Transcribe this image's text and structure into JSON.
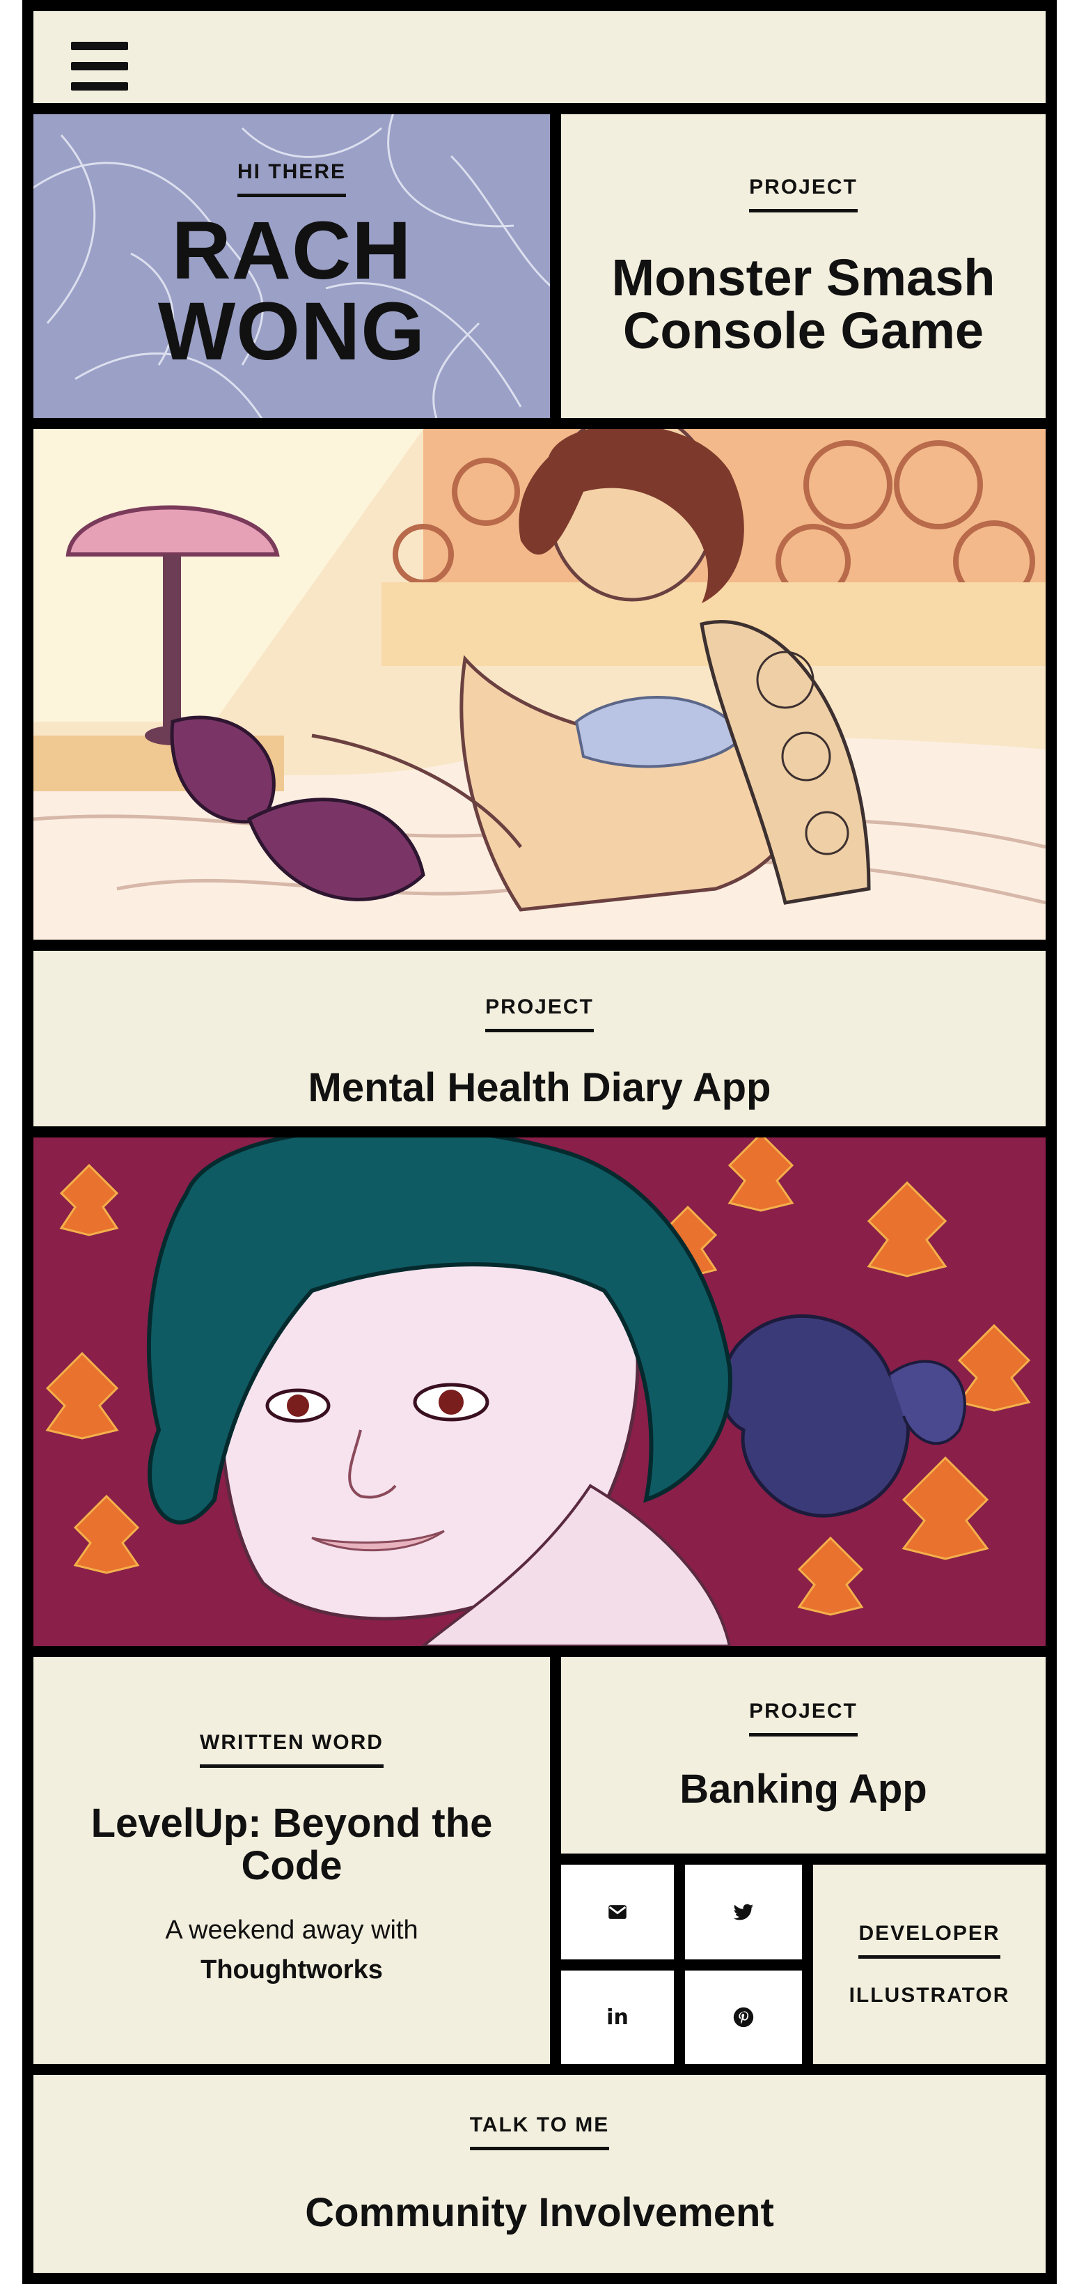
{
  "header": {
    "menu_icon": "hamburger-menu-icon"
  },
  "hero": {
    "kicker": "HI THERE",
    "name_line1": "RACH",
    "name_line2": "WONG"
  },
  "tiles": {
    "monster": {
      "kicker": "PROJECT",
      "title": "Monster Smash Console Game"
    },
    "mental": {
      "kicker": "PROJECT",
      "title": "Mental Health Diary App"
    },
    "written": {
      "kicker": "WRITTEN WORD",
      "title": "LevelUp: Beyond the Code",
      "subtitle": "A weekend away with",
      "subtitle_bold": "Thoughtworks"
    },
    "banking": {
      "kicker": "PROJECT",
      "title": "Banking App"
    },
    "roles": {
      "developer": "DEVELOPER",
      "illustrator": "ILLUSTRATOR"
    },
    "talk": {
      "kicker": "TALK TO ME",
      "title": "Community Involvement"
    }
  },
  "social": [
    {
      "name": "email-icon"
    },
    {
      "name": "twitter-icon"
    },
    {
      "name": "linkedin-icon",
      "label": "in"
    },
    {
      "name": "pinterest-icon"
    }
  ],
  "colors": {
    "tile_bg": "#f3efde",
    "grid_border": "#000000",
    "hero_bg": "#9a9ec4",
    "illustration_1_bg": "#f5d2a8",
    "illustration_2_bg": "#8a1f4a",
    "hair_teal": "#0f5b63"
  }
}
